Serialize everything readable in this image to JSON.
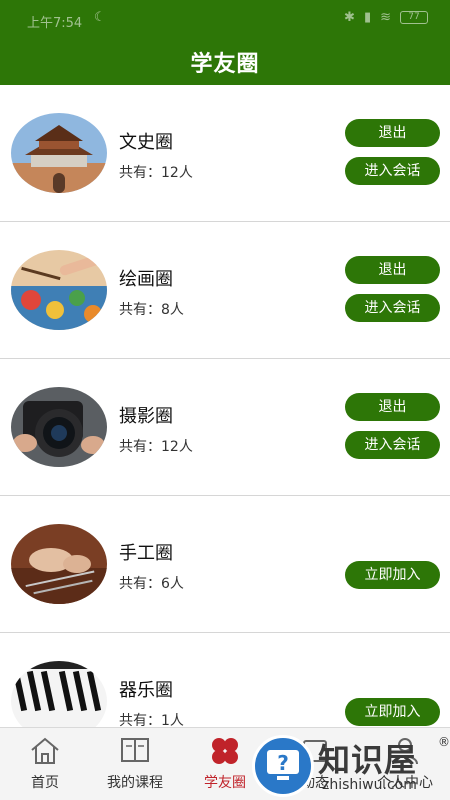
{
  "status_bar": {
    "time": "上午7:54",
    "battery": "77"
  },
  "header": {
    "title": "学友圈"
  },
  "circles": [
    {
      "name": "文史圈",
      "members": "共有：12人",
      "exit_label": "退出",
      "enter_label": "进入会话"
    },
    {
      "name": "绘画圈",
      "members": "共有：8人",
      "exit_label": "退出",
      "enter_label": "进入会话"
    },
    {
      "name": "摄影圈",
      "members": "共有：12人",
      "exit_label": "退出",
      "enter_label": "进入会话"
    },
    {
      "name": "手工圈",
      "members": "共有：6人",
      "join_label": "立即加入"
    },
    {
      "name": "器乐圈",
      "members": "共有：1人",
      "join_label": "立即加入"
    }
  ],
  "tabbar": {
    "items": [
      {
        "label": "首页",
        "icon": "home-icon"
      },
      {
        "label": "我的课程",
        "icon": "book-icon"
      },
      {
        "label": "学友圈",
        "icon": "clover-icon"
      },
      {
        "label": "动态",
        "icon": "feed-icon"
      },
      {
        "label": "个人中心",
        "icon": "person-icon"
      }
    ],
    "active_index": 2
  },
  "watermark": {
    "text": "知识屋",
    "url": "zhishiwu.com"
  },
  "colors": {
    "primary": "#2d7607",
    "active_tab": "#c0232a"
  }
}
